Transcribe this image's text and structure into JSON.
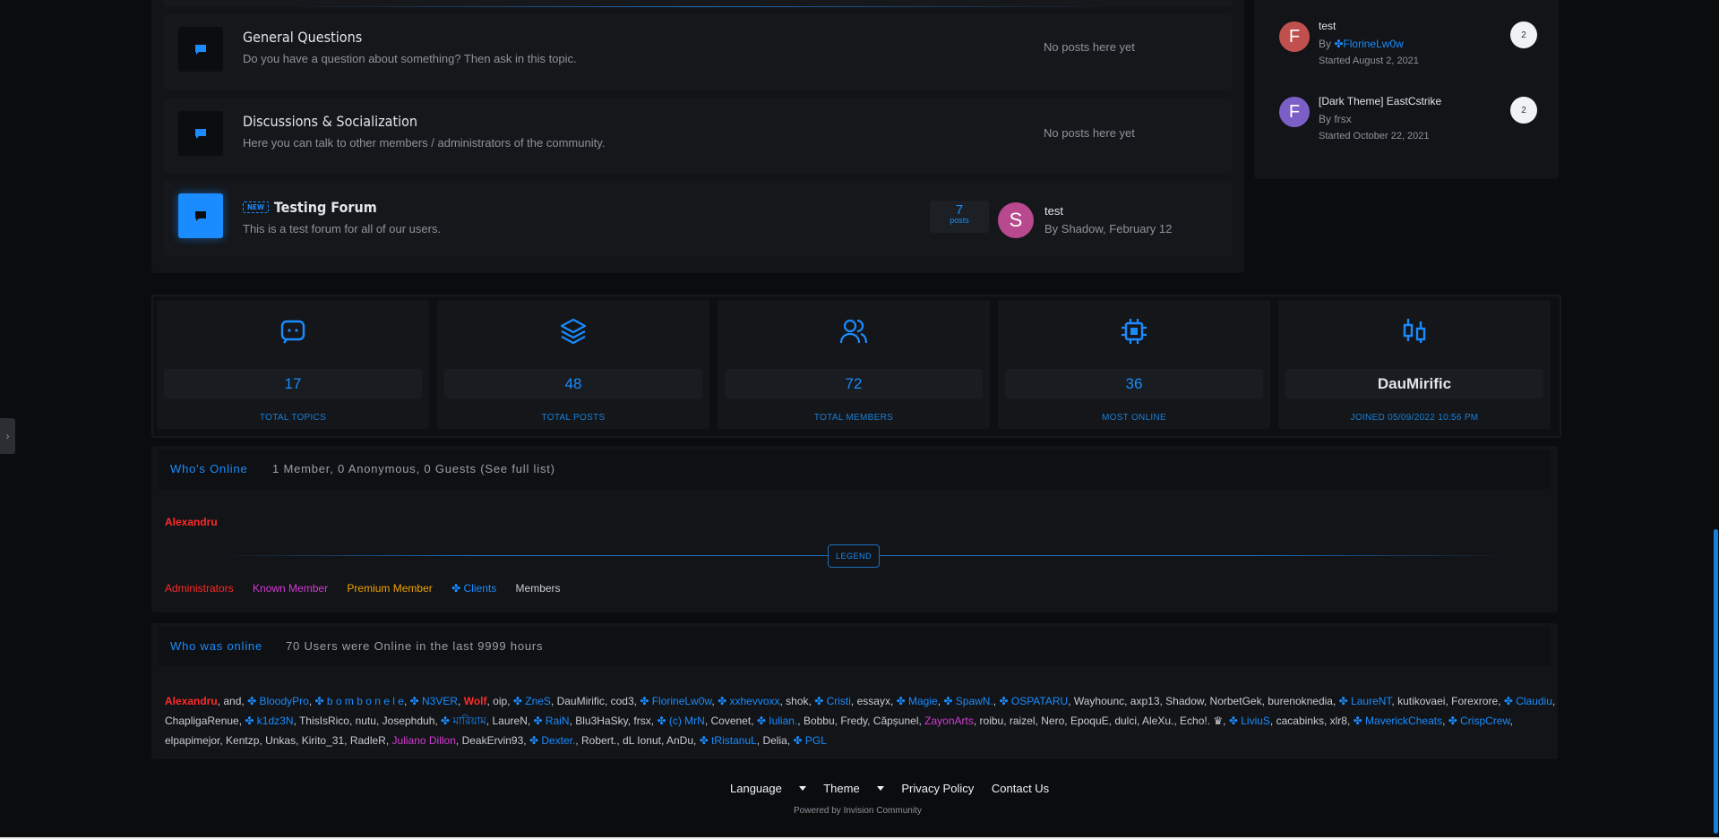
{
  "forums": [
    {
      "title": "General Questions",
      "description": "Do you have a question about something? Then ask in this topic.",
      "last_post": "No posts here yet"
    },
    {
      "title": "Discussions & Socialization",
      "description": "Here you can talk to other members / administrators of the community.",
      "last_post": "No posts here yet"
    },
    {
      "title": "Testing Forum",
      "badge": "NEW",
      "description": "This is a test forum for all of our users.",
      "post_count": "7",
      "post_label": "posts",
      "last_avatar": "S",
      "last_title": "test",
      "last_meta": "By Shadow, February 12"
    }
  ],
  "topics": [
    {
      "avatar": "F",
      "avatar_color": "#c0504d",
      "title": "test",
      "by_prefix": "By",
      "author": "FlorineLw0w",
      "started": "Started August 2, 2021",
      "replies": "2"
    },
    {
      "avatar": "F",
      "avatar_color": "#7b5fc7",
      "title": "[Dark Theme] EastCstrike",
      "by_prefix": "By",
      "author": "frsx",
      "started": "Started October 22, 2021",
      "replies": "2"
    }
  ],
  "stats": [
    {
      "value": "17",
      "label": "TOTAL TOPICS",
      "icon": "chat-icon"
    },
    {
      "value": "48",
      "label": "TOTAL POSTS",
      "icon": "layers-icon"
    },
    {
      "value": "72",
      "label": "TOTAL MEMBERS",
      "icon": "users-icon"
    },
    {
      "value": "36",
      "label": "MOST ONLINE",
      "icon": "cpu-icon"
    },
    {
      "value": "DauMirific",
      "label": "JOINED 05/09/2022 10:56 PM",
      "icon": "candles-icon"
    }
  ],
  "whos_online": {
    "title": "Who's Online",
    "summary": "1 Member, 0 Anonymous, 0 Guests (See full list)",
    "member": "Alexandru",
    "legend_label": "LEGEND",
    "legend": [
      "Administrators",
      "Known Member",
      "Premium Member",
      "Clients",
      "Members"
    ]
  },
  "was_online": {
    "title": "Who was online",
    "summary": "70 Users were Online in the last 9999 hours",
    "users": [
      {
        "name": "Alexandru",
        "type": "admin"
      },
      {
        "name": "and",
        "type": "member"
      },
      {
        "name": "BloodyPro",
        "type": "client"
      },
      {
        "name": "b o m b o n e l e",
        "type": "client"
      },
      {
        "name": "N3VER",
        "type": "client"
      },
      {
        "name": "Wolf",
        "type": "admin"
      },
      {
        "name": "oip",
        "type": "member"
      },
      {
        "name": "ZneS",
        "type": "client"
      },
      {
        "name": "DauMirific",
        "type": "member"
      },
      {
        "name": "cod3",
        "type": "member"
      },
      {
        "name": "FlorineLw0w",
        "type": "client"
      },
      {
        "name": "xxhevvoxx",
        "type": "client"
      },
      {
        "name": "shok",
        "type": "member"
      },
      {
        "name": "Cristi",
        "type": "client"
      },
      {
        "name": "essayx",
        "type": "member"
      },
      {
        "name": "Magie",
        "type": "client"
      },
      {
        "name": "SpawN.",
        "type": "client"
      },
      {
        "name": "OSPATARU",
        "type": "client"
      },
      {
        "name": "Wayhounc",
        "type": "member"
      },
      {
        "name": "axp13",
        "type": "member"
      },
      {
        "name": "Shadow",
        "type": "member"
      },
      {
        "name": "NorbetGek",
        "type": "member"
      },
      {
        "name": "burenoknedia",
        "type": "member"
      },
      {
        "name": "LaureNT",
        "type": "client"
      },
      {
        "name": "kutikovaei",
        "type": "member"
      },
      {
        "name": "Forexrore",
        "type": "member"
      },
      {
        "name": "Claudiu",
        "type": "client"
      },
      {
        "name": "ChapligaRenue",
        "type": "member"
      },
      {
        "name": "k1dz3N",
        "type": "client"
      },
      {
        "name": "ThisIsRico",
        "type": "member"
      },
      {
        "name": "nutu",
        "type": "member"
      },
      {
        "name": "Josephduh",
        "type": "member"
      },
      {
        "name": "মারিয়াম",
        "type": "client"
      },
      {
        "name": "LaureN",
        "type": "member"
      },
      {
        "name": "RaiN",
        "type": "client"
      },
      {
        "name": "Blu3HaSky",
        "type": "member"
      },
      {
        "name": "frsx",
        "type": "member"
      },
      {
        "name": "(c) MrN",
        "type": "client"
      },
      {
        "name": "Covenet",
        "type": "member"
      },
      {
        "name": "Iulian.",
        "type": "client"
      },
      {
        "name": "Bobbu",
        "type": "member"
      },
      {
        "name": "Fredy",
        "type": "member"
      },
      {
        "name": "Căpșunel",
        "type": "member"
      },
      {
        "name": "ZayonArts",
        "type": "known"
      },
      {
        "name": "roibu",
        "type": "member"
      },
      {
        "name": "raizel",
        "type": "member"
      },
      {
        "name": "Nero",
        "type": "member"
      },
      {
        "name": "EpoquE",
        "type": "member"
      },
      {
        "name": "dulci",
        "type": "member"
      },
      {
        "name": "AleXu.",
        "type": "member"
      },
      {
        "name": "Echo!. ♛",
        "type": "member"
      },
      {
        "name": "LiviuS",
        "type": "client"
      },
      {
        "name": "cacabinks",
        "type": "member"
      },
      {
        "name": "xlr8",
        "type": "member"
      },
      {
        "name": "MaverickCheats",
        "type": "client"
      },
      {
        "name": "CrispCrew",
        "type": "client"
      },
      {
        "name": "elpapimejor",
        "type": "member"
      },
      {
        "name": "Kentzp",
        "type": "member"
      },
      {
        "name": "Unkas",
        "type": "member"
      },
      {
        "name": "Kirito_31",
        "type": "member"
      },
      {
        "name": "RadleR",
        "type": "member"
      },
      {
        "name": "Juliano Dillon",
        "type": "known"
      },
      {
        "name": "DeakErvin93",
        "type": "member"
      },
      {
        "name": "Dexter.",
        "type": "client"
      },
      {
        "name": "Robert.",
        "type": "member"
      },
      {
        "name": "dL Ionut",
        "type": "member"
      },
      {
        "name": "AnDu",
        "type": "member"
      },
      {
        "name": "tRistanuL",
        "type": "client"
      },
      {
        "name": "Delia",
        "type": "member"
      },
      {
        "name": "PGL",
        "type": "client"
      }
    ]
  },
  "footer": {
    "nav": [
      "Language",
      "Theme",
      "Privacy Policy",
      "Contact Us"
    ],
    "powered": "Powered by Invision Community"
  },
  "colors": {
    "accent": "#1a8cff",
    "admin": "#ff2a2a",
    "known_member": "#d43bd4",
    "premium": "#f0a400",
    "client": "#1a8cff"
  }
}
